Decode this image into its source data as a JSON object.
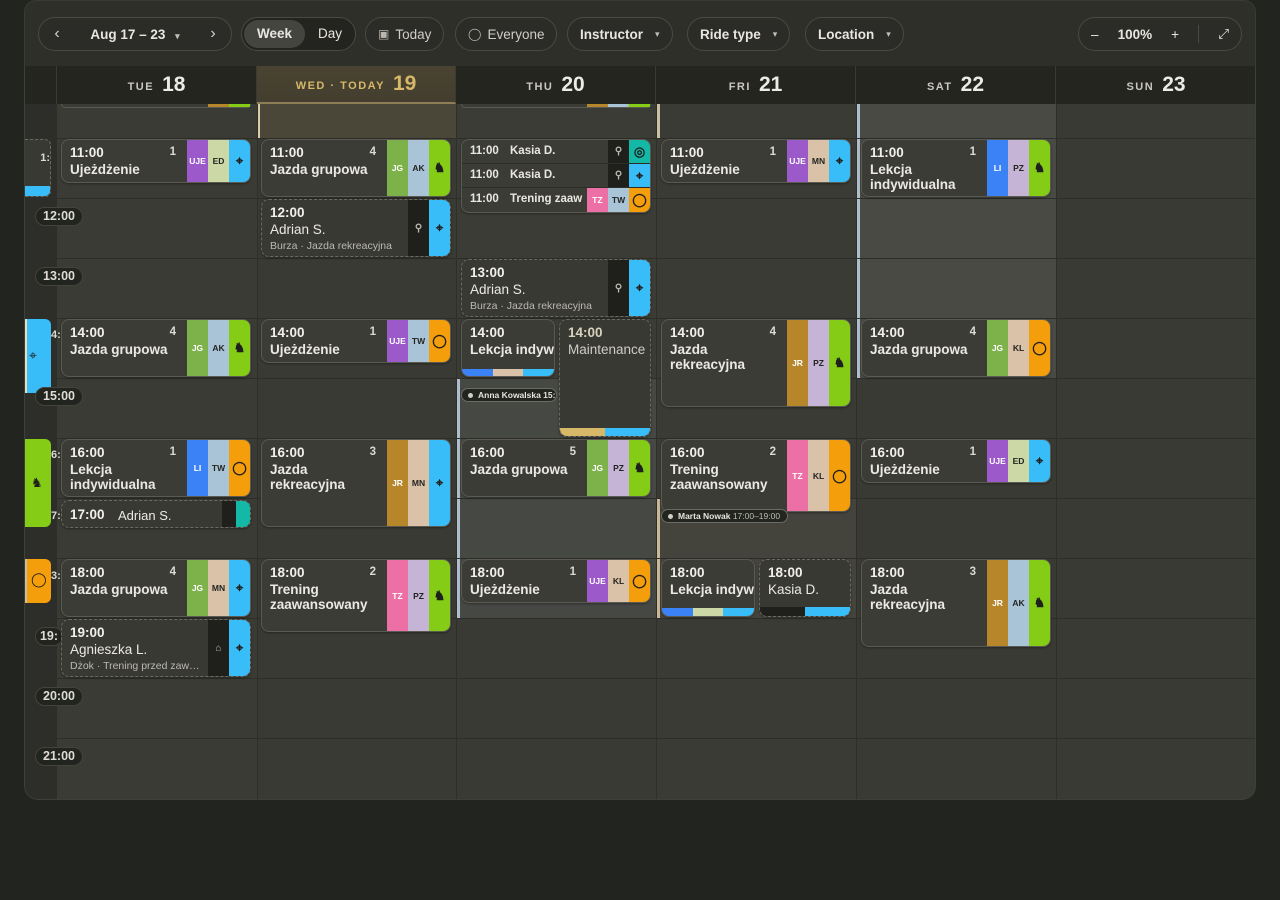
{
  "toolbar": {
    "prev_icon": "chevron-left-icon",
    "next_icon": "chevron-right-icon",
    "date_range": "Aug 17 – 23",
    "view_week": "Week",
    "view_day": "Day",
    "today": "Today",
    "everyone": "Everyone",
    "instructor": "Instructor",
    "ride_type": "Ride type",
    "location": "Location",
    "zoom_out": "–",
    "zoom_level": "100%",
    "zoom_in": "+",
    "fullscreen_icon": "expand-icon"
  },
  "days": [
    {
      "dow": "TUE",
      "num": "18"
    },
    {
      "dow": "WED · TODAY",
      "num": "19"
    },
    {
      "dow": "THU",
      "num": "20"
    },
    {
      "dow": "FRI",
      "num": "21"
    },
    {
      "dow": "SAT",
      "num": "22"
    },
    {
      "dow": "SUN",
      "num": "23"
    }
  ],
  "times": [
    "12:00",
    "13:00",
    "15:00",
    "20:00",
    "21:00"
  ],
  "partial_times": [
    "1:",
    "4:",
    "6:",
    "7:",
    "3:",
    "19:"
  ],
  "colors": {
    "accent_today": "#d6b868",
    "ride_blue": "#38bdf8",
    "ride_orange": "#f59e0b",
    "ride_green": "#84cc16",
    "ride_teal": "#14b8a6"
  },
  "events": {
    "tue_1100": {
      "time": "11:00",
      "count": "1",
      "title": "Ujeżdżenie",
      "tags": [
        "UJE",
        "ED"
      ],
      "icon": "location-pin-icon"
    },
    "tue_1400": {
      "time": "14:00",
      "count": "4",
      "title": "Jazda grupowa",
      "tags": [
        "JG",
        "AK"
      ],
      "icon": "horse-icon"
    },
    "tue_1600": {
      "time": "16:00",
      "count": "1",
      "title": "Lekcja indywidualna",
      "tags": [
        "LI",
        "TW"
      ],
      "icon": "circle-icon"
    },
    "tue_1700": {
      "time": "17:00",
      "title": "Adrian S."
    },
    "tue_1800": {
      "time": "18:00",
      "count": "4",
      "title": "Jazda grupowa",
      "tags": [
        "JG",
        "MN"
      ],
      "icon": "location-pin-icon"
    },
    "tue_1900": {
      "time": "19:00",
      "title": "Agnieszka L.",
      "sub": "Dżok · Trening przed zaw…",
      "icon": "lock-icon"
    },
    "wed_1100": {
      "time": "11:00",
      "count": "4",
      "title": "Jazda grupowa",
      "tags": [
        "JG",
        "AK"
      ],
      "icon": "horse-icon"
    },
    "wed_1200": {
      "time": "12:00",
      "title": "Adrian S.",
      "sub": "Burza · Jazda rekreacyjna",
      "icon": "location-pin-icon"
    },
    "wed_1400": {
      "time": "14:00",
      "count": "1",
      "title": "Ujeżdżenie",
      "tags": [
        "UJE",
        "TW"
      ],
      "icon": "circle-icon"
    },
    "wed_1600": {
      "time": "16:00",
      "count": "3",
      "title": "Jazda rekreacyjna",
      "tags": [
        "JR",
        "MN"
      ],
      "icon": "location-pin-icon"
    },
    "wed_1800": {
      "time": "18:00",
      "count": "2",
      "title": "Trening zaawansowany",
      "tags": [
        "TZ",
        "PZ"
      ],
      "icon": "horse-icon"
    },
    "thu_1100": {
      "rows": [
        {
          "time": "11:00",
          "name": "Kasia D."
        },
        {
          "time": "11:00",
          "name": "Kasia D."
        },
        {
          "time": "11:00",
          "name": "Trening zaaw",
          "tags": [
            "TZ",
            "TW"
          ]
        }
      ]
    },
    "thu_1300": {
      "time": "13:00",
      "title": "Adrian S.",
      "sub": "Burza · Jazda rekreacyjna",
      "icon": "location-pin-icon"
    },
    "thu_1400a": {
      "time": "14:00",
      "title": "Lekcja indywidualn"
    },
    "thu_1400b": {
      "time": "14:00",
      "title": "Maintenance"
    },
    "thu_bubble": "Anna Kowalska  15:",
    "thu_1600": {
      "time": "16:00",
      "count": "5",
      "title": "Jazda grupowa",
      "tags": [
        "JG",
        "PZ"
      ],
      "icon": "horse-icon"
    },
    "thu_1800": {
      "time": "18:00",
      "count": "1",
      "title": "Ujeżdżenie",
      "tags": [
        "UJE",
        "KL"
      ],
      "icon": "circle-icon"
    },
    "fri_1100": {
      "time": "11:00",
      "count": "1",
      "title": "Ujeżdżenie",
      "tags": [
        "UJE",
        "MN"
      ],
      "icon": "location-pin-icon"
    },
    "fri_1400": {
      "time": "14:00",
      "count": "4",
      "title": "Jazda rekreacyjna",
      "tags": [
        "JR",
        "PZ"
      ],
      "icon": "horse-icon"
    },
    "fri_1600": {
      "time": "16:00",
      "count": "2",
      "title": "Trening zaawansowany",
      "tags": [
        "TZ",
        "KL"
      ],
      "icon": "circle-icon"
    },
    "fri_bubble": {
      "name": "Marta Nowak",
      "range": "17:00–19:00"
    },
    "fri_1800a": {
      "time": "18:00",
      "title": "Lekcja indywidualn"
    },
    "fri_1800b": {
      "time": "18:00",
      "title": "Kasia D."
    },
    "sat_1100": {
      "time": "11:00",
      "count": "1",
      "title": "Lekcja indywidualna",
      "tags": [
        "LI",
        "PZ"
      ],
      "icon": "horse-icon"
    },
    "sat_1400": {
      "time": "14:00",
      "count": "4",
      "title": "Jazda grupowa",
      "tags": [
        "JG",
        "KL"
      ],
      "icon": "circle-icon"
    },
    "sat_1600": {
      "time": "16:00",
      "count": "1",
      "title": "Ujeżdżenie",
      "tags": [
        "UJE",
        "ED"
      ],
      "icon": "location-pin-icon"
    },
    "sat_1800": {
      "time": "18:00",
      "count": "3",
      "title": "Jazda rekreacyjna",
      "tags": [
        "JR",
        "AK"
      ],
      "icon": "horse-icon"
    }
  }
}
